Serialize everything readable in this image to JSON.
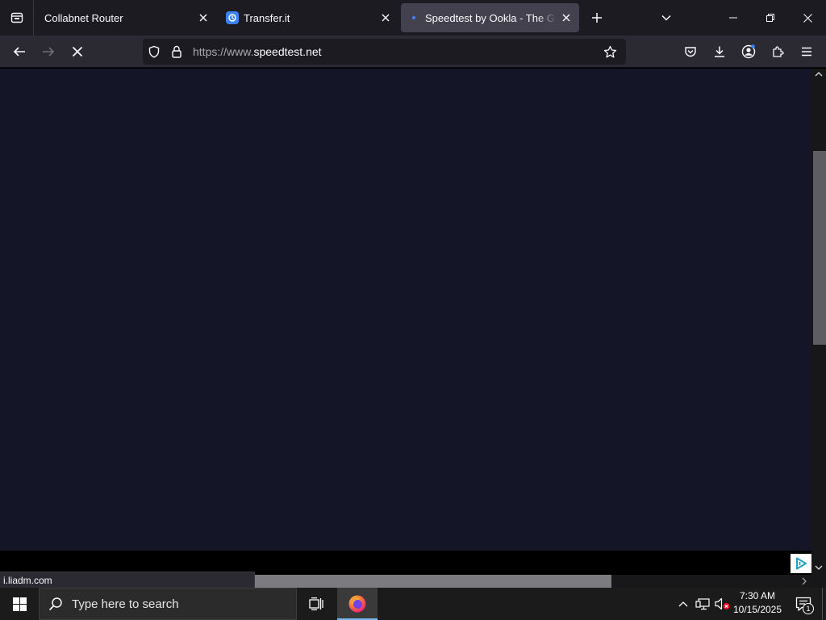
{
  "browser": {
    "tabs": [
      {
        "title": "Collabnet Router",
        "favicon": "none"
      },
      {
        "title": "Transfer.it",
        "favicon": "transfer-icon"
      },
      {
        "title": "Speedtest by Ookla - The Global Broadband Speed Test",
        "favicon": "loading-dot",
        "active": true,
        "loading": true
      }
    ],
    "url": {
      "prefix": "https://www.",
      "domain": "speedtest.net"
    },
    "status_text": "i.liadm.com",
    "accent": "#3b82f6"
  },
  "page": {
    "background": "#141526"
  },
  "taskbar": {
    "search_placeholder": "Type here to search",
    "clock_time": "7:30 AM",
    "clock_date": "10/15/2025",
    "notification_count": "1"
  }
}
